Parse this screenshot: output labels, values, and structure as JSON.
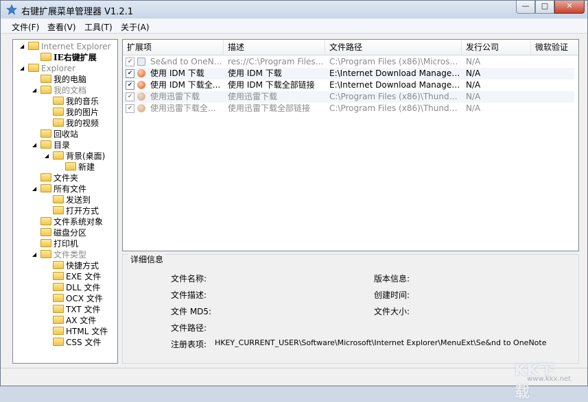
{
  "window": {
    "title": "右键扩展菜单管理器 V1.2.1",
    "minimize": "—",
    "maximize": "□",
    "close": "✕"
  },
  "menu": [
    "文件(F)",
    "查看(V)",
    "工具(T)",
    "关于(A)"
  ],
  "tree": [
    {
      "label": "Internet Explorer",
      "grey": true
    },
    {
      "label": "IE右键扩展",
      "bold": true
    },
    {
      "label": "Explorer",
      "grey": true
    },
    {
      "label": "我的电脑"
    },
    {
      "label": "我的文档",
      "grey": true
    },
    {
      "label": "我的音乐"
    },
    {
      "label": "我的图片"
    },
    {
      "label": "我的视频"
    },
    {
      "label": "回收站"
    },
    {
      "label": "目录"
    },
    {
      "label": "背景(桌面)"
    },
    {
      "label": "新建"
    },
    {
      "label": "文件夹"
    },
    {
      "label": "所有文件"
    },
    {
      "label": "发送到"
    },
    {
      "label": "打开方式"
    },
    {
      "label": "文件系统对象"
    },
    {
      "label": "磁盘分区"
    },
    {
      "label": "打印机"
    },
    {
      "label": "文件类型",
      "grey": true
    },
    {
      "label": "快捷方式"
    },
    {
      "label": "DLL 文件"
    },
    {
      "label": "OCX 文件"
    },
    {
      "label": "TXT 文件"
    },
    {
      "label": "AX 文件"
    },
    {
      "label": "HTML 文件"
    },
    {
      "label": "CSS 文件"
    },
    {
      "label": "EXE 文件"
    }
  ],
  "list": {
    "columns": [
      "扩展项",
      "描述",
      "文件路径",
      "发行公司",
      "微软验证"
    ],
    "rows": [
      {
        "name": "Se&nd to OneNote",
        "desc": "res://C:\\Program Files (x...",
        "path": "C:\\Program Files (x86)\\Microsoft Of...",
        "company": "N/A",
        "verify": "",
        "disabled": true,
        "icon": "onenote"
      },
      {
        "name": "使用 IDM 下载",
        "desc": "使用 IDM 下载",
        "path": "E:\\Internet Download Manager\\IEE...",
        "company": "N/A",
        "verify": "",
        "disabled": false,
        "icon": "idm"
      },
      {
        "name": "使用 IDM 下载全...",
        "desc": "使用 IDM 下载全部链接",
        "path": "E:\\Internet Download Manager\\IEG...",
        "company": "N/A",
        "verify": "",
        "disabled": false,
        "icon": "idm"
      },
      {
        "name": "使用迅雷下载",
        "desc": "使用迅雷下载",
        "path": "C:\\Program Files (x86)\\Thunder\\Pro...",
        "company": "N/A",
        "verify": "",
        "disabled": true,
        "icon": "thunder"
      },
      {
        "name": "使用迅雷下载全...",
        "desc": "使用迅雷下载全部链接",
        "path": "C:\\Program Files (x86)\\Thunder\\Pro...",
        "company": "N/A",
        "verify": "",
        "disabled": true,
        "icon": "thunder"
      }
    ],
    "check_mark": "✔"
  },
  "details": {
    "legend": "详细信息",
    "file_name": "文件名称:",
    "file_desc": "文件描述:",
    "file_md5": "文件 MD5:",
    "file_path": "文件路径:",
    "reg_key": "注册表项:",
    "reg_value": "HKEY_CURRENT_USER\\Software\\Microsoft\\Internet Explorer\\MenuExt\\Se&nd to OneNote",
    "version": "版本信息:",
    "created": "创建时间:",
    "size": "文件大小:"
  },
  "watermark": {
    "text": "KK下载",
    "url": "www.kkx.net"
  }
}
